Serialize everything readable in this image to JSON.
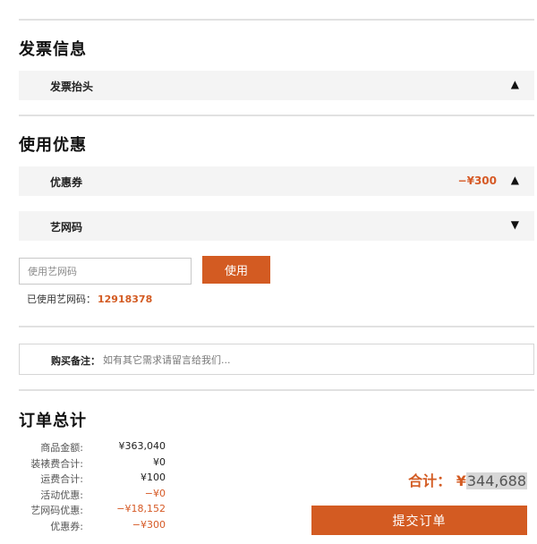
{
  "invoice": {
    "title": "发票信息",
    "header_label": "发票抬头",
    "header_arrow": "▲"
  },
  "discount": {
    "title": "使用优惠",
    "coupon": {
      "label": "优惠券",
      "value": "−¥300",
      "arrow": "▲"
    },
    "art_code": {
      "label": "艺网码",
      "arrow": "▼"
    },
    "code_input": {
      "placeholder": "使用艺网码",
      "value": ""
    },
    "use_button": "使用",
    "used_code_label": "已使用艺网码：",
    "used_code_value": "12918378"
  },
  "remark": {
    "label": "购买备注：",
    "placeholder": "如有其它需求请留言给我们..."
  },
  "order_total": {
    "title": "订单总计",
    "rows": [
      {
        "label": "商品金额:",
        "value": "¥363,040",
        "negative": false
      },
      {
        "label": "装裱费合计:",
        "value": "¥0",
        "negative": false
      },
      {
        "label": "运费合计:",
        "value": "¥100",
        "negative": false
      },
      {
        "label": "活动优惠:",
        "value": "−¥0",
        "negative": true
      },
      {
        "label": "艺网码优惠:",
        "value": "−¥18,152",
        "negative": true
      },
      {
        "label": "优惠券:",
        "value": "−¥300",
        "negative": true
      }
    ],
    "total_label": "合计：",
    "total_currency": "¥",
    "total_value": "344,688",
    "submit_button": "提交订单"
  },
  "colors": {
    "accent": "#d35b22",
    "bar_bg": "#f4f4f4",
    "divider": "#e1e1e1"
  }
}
